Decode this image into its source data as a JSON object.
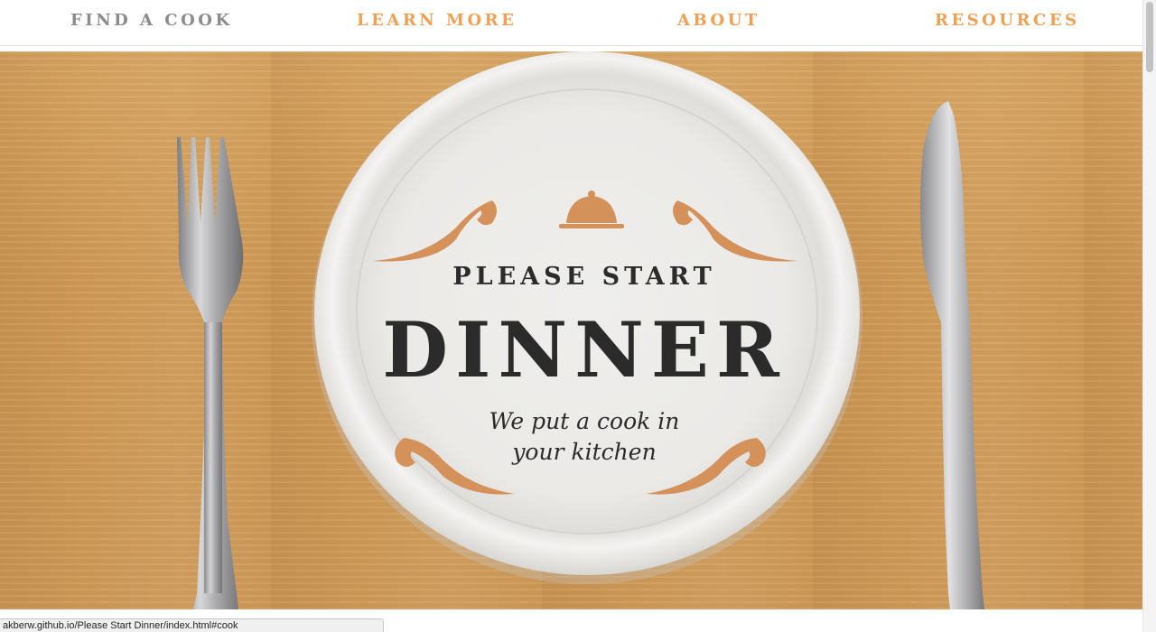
{
  "nav": {
    "items": [
      {
        "label": "FIND A COOK",
        "state": "active"
      },
      {
        "label": "LEARN MORE",
        "state": "normal"
      },
      {
        "label": "ABOUT",
        "state": "normal"
      },
      {
        "label": "RESOURCES",
        "state": "normal"
      }
    ]
  },
  "hero": {
    "kicker": "PLEASE START",
    "title": "DINNER",
    "tagline_line1": "We put a cook in",
    "tagline_line2": "your kitchen"
  },
  "status_bar": {
    "url": "akberw.github.io/Please Start Dinner/index.html#cook"
  },
  "colors": {
    "accent_orange": "#f0a055",
    "nav_active_gray": "#8c8c8c",
    "ornament_copper": "#d4915a",
    "title_dark": "#2b2b2b",
    "table_wood": "#d29c5a"
  }
}
